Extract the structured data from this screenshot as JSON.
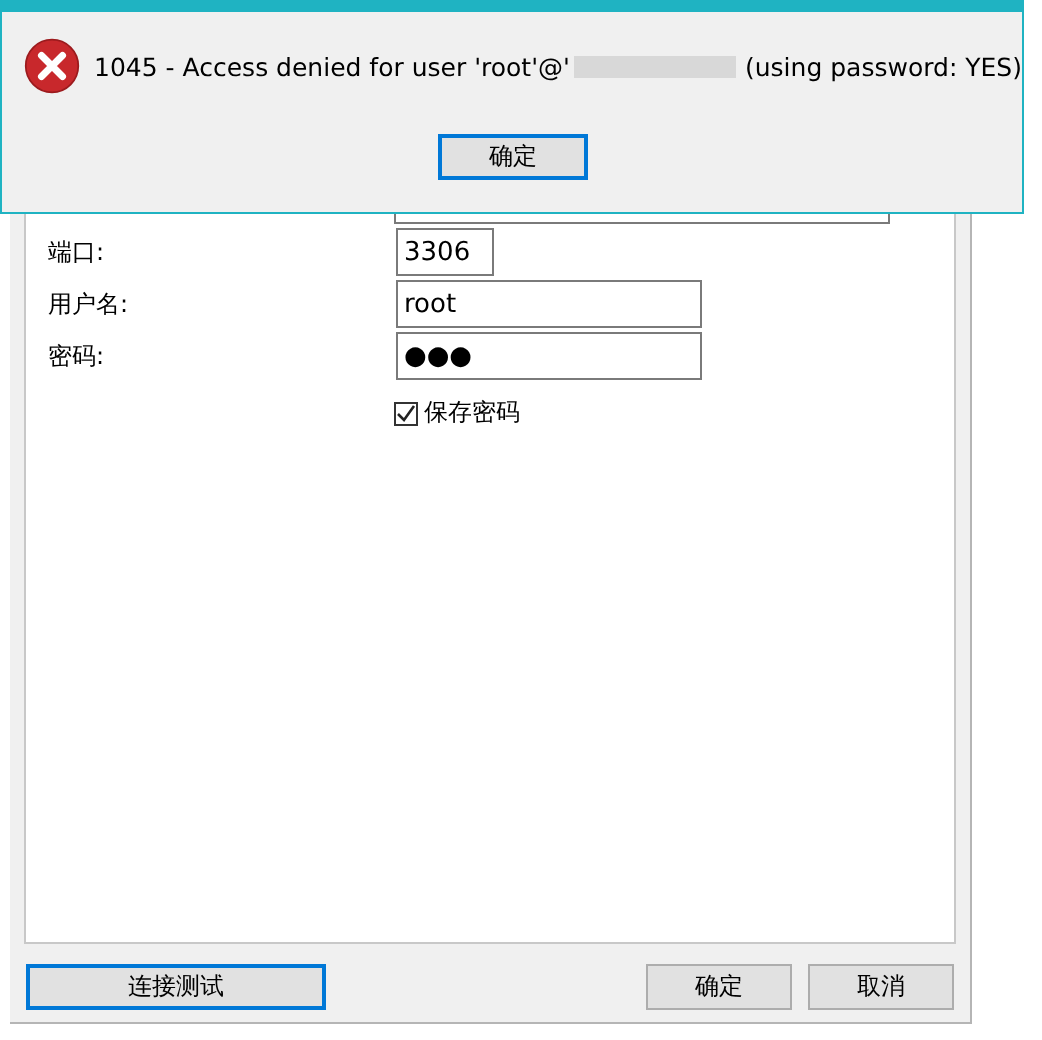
{
  "error_alert": {
    "message": "1045 - Access denied for user 'root'@'",
    "message_end": "(using password: YES)",
    "ok_button": "确定"
  },
  "form": {
    "fields": [
      {
        "label": "端口:",
        "value": "3306",
        "kind": "short"
      },
      {
        "label": "用户名:",
        "value": "root",
        "kind": "long"
      },
      {
        "label": "密码:",
        "value": "●●●",
        "kind": "long"
      }
    ],
    "save_password": {
      "label": "保存密码",
      "checked": true
    }
  },
  "buttons": {
    "test": "连接测试",
    "ok": "确定",
    "cancel": "取消"
  }
}
